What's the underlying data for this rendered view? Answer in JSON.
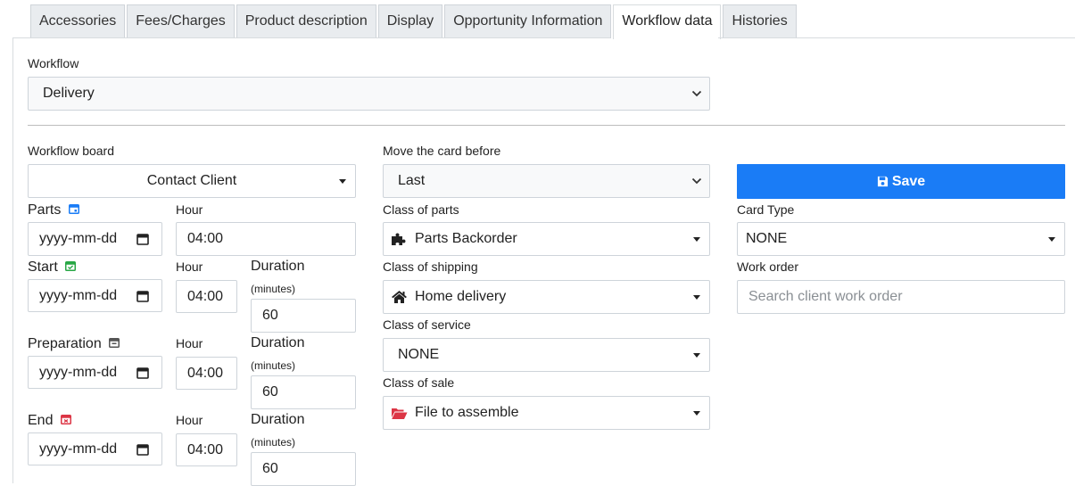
{
  "tabs": [
    {
      "label": "Accessories",
      "active": false
    },
    {
      "label": "Fees/Charges",
      "active": false
    },
    {
      "label": "Product description",
      "active": false
    },
    {
      "label": "Display",
      "active": false
    },
    {
      "label": "Opportunity Information",
      "active": false
    },
    {
      "label": "Workflow data",
      "active": true
    },
    {
      "label": "Histories",
      "active": false
    }
  ],
  "workflow": {
    "label": "Workflow",
    "value": "Delivery"
  },
  "board": {
    "label": "Workflow board",
    "value": "Contact Client"
  },
  "move_before": {
    "label": "Move the card before",
    "value": "Last"
  },
  "save": {
    "label": "Save",
    "color": "#1a7cf6"
  },
  "date_placeholder": "yyyy-mm-dd",
  "hour_label": "Hour",
  "duration_label": "Duration",
  "minutes_label": "(minutes)",
  "parts": {
    "label": "Parts",
    "hour": "04:00",
    "icon_color": "#1a7cf6"
  },
  "start": {
    "label": "Start",
    "hour": "04:00",
    "duration": "60",
    "icon_color": "#28a745"
  },
  "preparation": {
    "label": "Preparation",
    "hour": "04:00",
    "duration": "60",
    "icon_color": "#555555"
  },
  "end": {
    "label": "End",
    "hour": "04:00",
    "duration": "60",
    "icon_color": "#dc3545"
  },
  "class_parts": {
    "label": "Class of parts",
    "value": "Parts Backorder",
    "icon": "puzzle-icon"
  },
  "class_shipping": {
    "label": "Class of shipping",
    "value": "Home delivery",
    "icon": "home-icon"
  },
  "class_service": {
    "label": "Class of service",
    "value": "NONE"
  },
  "class_sale": {
    "label": "Class of sale",
    "value": "File to assemble",
    "icon": "folder-open-icon",
    "icon_color": "#dc3545"
  },
  "card_type": {
    "label": "Card Type",
    "value": "NONE"
  },
  "work_order": {
    "label": "Work order",
    "placeholder": "Search client work order"
  }
}
